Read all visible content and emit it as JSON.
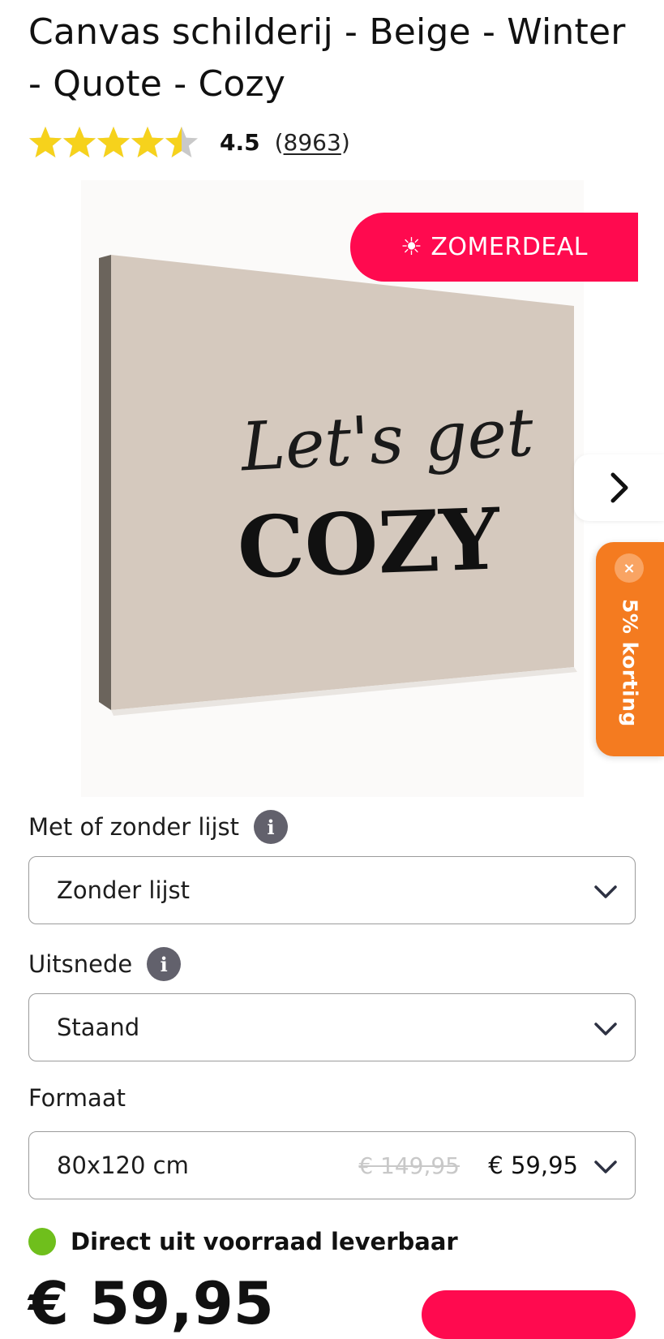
{
  "product": {
    "title": "Canvas schilderij - Beige - Winter - Quote - Cozy",
    "rating": 4.5,
    "rating_label": "4.5",
    "review_count": "8963",
    "rating_max": 5
  },
  "gallery": {
    "badge_label": "ZOMERDEAL",
    "badge_icon": "sun-icon",
    "artwork_script_text": "Let's get",
    "artwork_main_text": "COZY",
    "next_icon": "chevron-right-icon"
  },
  "discount_tab": {
    "label": "5% korting",
    "close_symbol": "×"
  },
  "options": {
    "frame": {
      "label": "Met of zonder lijst",
      "value": "Zonder lijst"
    },
    "crop": {
      "label": "Uitsnede",
      "value": "Staand"
    },
    "size": {
      "label": "Formaat",
      "value": "80x120 cm",
      "old_price": "€ 149,95",
      "new_price": "€ 59,95"
    }
  },
  "stock": {
    "label": "Direct uit voorraad leverbaar"
  },
  "price_display": "€ 59,95",
  "colors": {
    "accent_red": "#ff0a4f",
    "discount_orange": "#f47b20",
    "stock_green": "#6fbf1c",
    "star_yellow": "#f6d21c",
    "canvas_beige": "#d5c9be"
  }
}
